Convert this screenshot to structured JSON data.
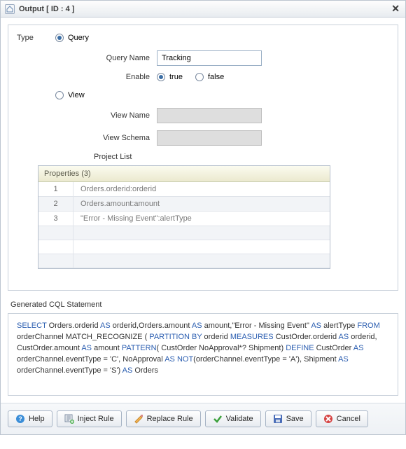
{
  "window": {
    "title": "Output [ ID : 4 ]"
  },
  "form": {
    "type_label": "Type",
    "query_radio": "Query",
    "view_radio": "View",
    "query_name_label": "Query Name",
    "query_name_value": "Tracking",
    "enable_label": "Enable",
    "enable_true": "true",
    "enable_false": "false",
    "view_name_label": "View Name",
    "view_schema_label": "View Schema",
    "project_list_label": "Project List"
  },
  "grid": {
    "header": "Properties (3)",
    "rows": [
      {
        "idx": "1",
        "value": "Orders.orderid:orderid"
      },
      {
        "idx": "2",
        "value": "Orders.amount:amount"
      },
      {
        "idx": "3",
        "value": "\"Error - Missing Event\":alertType"
      }
    ]
  },
  "cql": {
    "label": "Generated CQL Statement",
    "tokens": [
      {
        "t": "SELECT",
        "k": true
      },
      {
        "t": " Orders.orderid "
      },
      {
        "t": "AS",
        "k": true
      },
      {
        "t": " orderid,Orders.amount "
      },
      {
        "t": "AS",
        "k": true
      },
      {
        "t": " amount,\"Error - Missing Event\" "
      },
      {
        "t": "AS",
        "k": true
      },
      {
        "t": " alertType "
      },
      {
        "t": "FROM",
        "k": true
      },
      {
        "t": " orderChannel  MATCH_RECOGNIZE ( "
      },
      {
        "t": "PARTITION BY",
        "k": true
      },
      {
        "t": " orderid "
      },
      {
        "t": "MEASURES",
        "k": true
      },
      {
        "t": " CustOrder.orderid "
      },
      {
        "t": "AS",
        "k": true
      },
      {
        "t": " orderid, CustOrder.amount "
      },
      {
        "t": "AS",
        "k": true
      },
      {
        "t": " amount "
      },
      {
        "t": "PATTERN",
        "k": true
      },
      {
        "t": "( CustOrder NoApproval*? Shipment) "
      },
      {
        "t": "DEFINE",
        "k": true
      },
      {
        "t": " CustOrder "
      },
      {
        "t": "AS",
        "k": true
      },
      {
        "t": " orderChannel.eventType = 'C', NoApproval "
      },
      {
        "t": "AS",
        "k": true
      },
      {
        "t": " "
      },
      {
        "t": "NOT",
        "k": true
      },
      {
        "t": "(orderChannel.eventType = 'A'), Shipment "
      },
      {
        "t": "AS",
        "k": true
      },
      {
        "t": " orderChannel.eventType = 'S') "
      },
      {
        "t": "AS",
        "k": true
      },
      {
        "t": " Orders"
      }
    ]
  },
  "buttons": {
    "help": "Help",
    "inject": "Inject Rule",
    "replace": "Replace Rule",
    "validate": "Validate",
    "save": "Save",
    "cancel": "Cancel"
  }
}
